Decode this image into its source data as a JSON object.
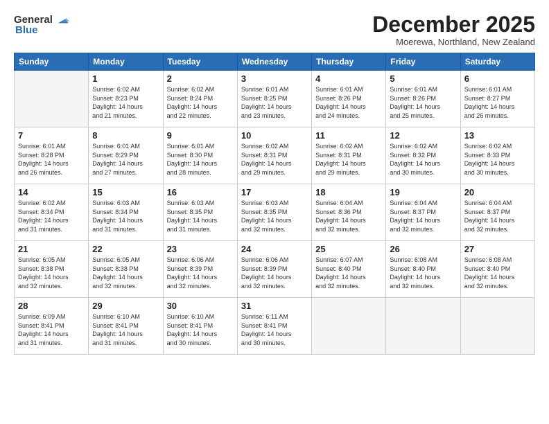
{
  "logo": {
    "general": "General",
    "blue": "Blue"
  },
  "title": "December 2025",
  "location": "Moerewa, Northland, New Zealand",
  "weekdays": [
    "Sunday",
    "Monday",
    "Tuesday",
    "Wednesday",
    "Thursday",
    "Friday",
    "Saturday"
  ],
  "weeks": [
    [
      {
        "day": "",
        "info": ""
      },
      {
        "day": "1",
        "info": "Sunrise: 6:02 AM\nSunset: 8:23 PM\nDaylight: 14 hours\nand 21 minutes."
      },
      {
        "day": "2",
        "info": "Sunrise: 6:02 AM\nSunset: 8:24 PM\nDaylight: 14 hours\nand 22 minutes."
      },
      {
        "day": "3",
        "info": "Sunrise: 6:01 AM\nSunset: 8:25 PM\nDaylight: 14 hours\nand 23 minutes."
      },
      {
        "day": "4",
        "info": "Sunrise: 6:01 AM\nSunset: 8:26 PM\nDaylight: 14 hours\nand 24 minutes."
      },
      {
        "day": "5",
        "info": "Sunrise: 6:01 AM\nSunset: 8:26 PM\nDaylight: 14 hours\nand 25 minutes."
      },
      {
        "day": "6",
        "info": "Sunrise: 6:01 AM\nSunset: 8:27 PM\nDaylight: 14 hours\nand 26 minutes."
      }
    ],
    [
      {
        "day": "7",
        "info": "Sunrise: 6:01 AM\nSunset: 8:28 PM\nDaylight: 14 hours\nand 26 minutes."
      },
      {
        "day": "8",
        "info": "Sunrise: 6:01 AM\nSunset: 8:29 PM\nDaylight: 14 hours\nand 27 minutes."
      },
      {
        "day": "9",
        "info": "Sunrise: 6:01 AM\nSunset: 8:30 PM\nDaylight: 14 hours\nand 28 minutes."
      },
      {
        "day": "10",
        "info": "Sunrise: 6:02 AM\nSunset: 8:31 PM\nDaylight: 14 hours\nand 29 minutes."
      },
      {
        "day": "11",
        "info": "Sunrise: 6:02 AM\nSunset: 8:31 PM\nDaylight: 14 hours\nand 29 minutes."
      },
      {
        "day": "12",
        "info": "Sunrise: 6:02 AM\nSunset: 8:32 PM\nDaylight: 14 hours\nand 30 minutes."
      },
      {
        "day": "13",
        "info": "Sunrise: 6:02 AM\nSunset: 8:33 PM\nDaylight: 14 hours\nand 30 minutes."
      }
    ],
    [
      {
        "day": "14",
        "info": "Sunrise: 6:02 AM\nSunset: 8:34 PM\nDaylight: 14 hours\nand 31 minutes."
      },
      {
        "day": "15",
        "info": "Sunrise: 6:03 AM\nSunset: 8:34 PM\nDaylight: 14 hours\nand 31 minutes."
      },
      {
        "day": "16",
        "info": "Sunrise: 6:03 AM\nSunset: 8:35 PM\nDaylight: 14 hours\nand 31 minutes."
      },
      {
        "day": "17",
        "info": "Sunrise: 6:03 AM\nSunset: 8:35 PM\nDaylight: 14 hours\nand 32 minutes."
      },
      {
        "day": "18",
        "info": "Sunrise: 6:04 AM\nSunset: 8:36 PM\nDaylight: 14 hours\nand 32 minutes."
      },
      {
        "day": "19",
        "info": "Sunrise: 6:04 AM\nSunset: 8:37 PM\nDaylight: 14 hours\nand 32 minutes."
      },
      {
        "day": "20",
        "info": "Sunrise: 6:04 AM\nSunset: 8:37 PM\nDaylight: 14 hours\nand 32 minutes."
      }
    ],
    [
      {
        "day": "21",
        "info": "Sunrise: 6:05 AM\nSunset: 8:38 PM\nDaylight: 14 hours\nand 32 minutes."
      },
      {
        "day": "22",
        "info": "Sunrise: 6:05 AM\nSunset: 8:38 PM\nDaylight: 14 hours\nand 32 minutes."
      },
      {
        "day": "23",
        "info": "Sunrise: 6:06 AM\nSunset: 8:39 PM\nDaylight: 14 hours\nand 32 minutes."
      },
      {
        "day": "24",
        "info": "Sunrise: 6:06 AM\nSunset: 8:39 PM\nDaylight: 14 hours\nand 32 minutes."
      },
      {
        "day": "25",
        "info": "Sunrise: 6:07 AM\nSunset: 8:40 PM\nDaylight: 14 hours\nand 32 minutes."
      },
      {
        "day": "26",
        "info": "Sunrise: 6:08 AM\nSunset: 8:40 PM\nDaylight: 14 hours\nand 32 minutes."
      },
      {
        "day": "27",
        "info": "Sunrise: 6:08 AM\nSunset: 8:40 PM\nDaylight: 14 hours\nand 32 minutes."
      }
    ],
    [
      {
        "day": "28",
        "info": "Sunrise: 6:09 AM\nSunset: 8:41 PM\nDaylight: 14 hours\nand 31 minutes."
      },
      {
        "day": "29",
        "info": "Sunrise: 6:10 AM\nSunset: 8:41 PM\nDaylight: 14 hours\nand 31 minutes."
      },
      {
        "day": "30",
        "info": "Sunrise: 6:10 AM\nSunset: 8:41 PM\nDaylight: 14 hours\nand 30 minutes."
      },
      {
        "day": "31",
        "info": "Sunrise: 6:11 AM\nSunset: 8:41 PM\nDaylight: 14 hours\nand 30 minutes."
      },
      {
        "day": "",
        "info": ""
      },
      {
        "day": "",
        "info": ""
      },
      {
        "day": "",
        "info": ""
      }
    ]
  ]
}
